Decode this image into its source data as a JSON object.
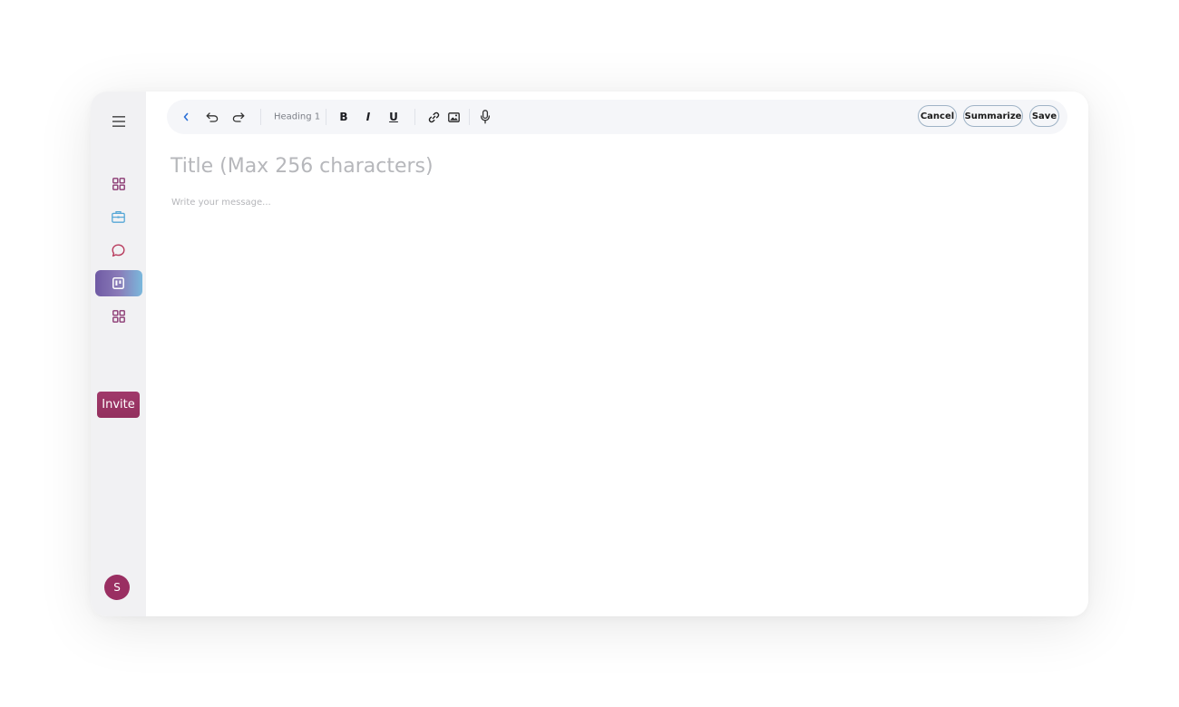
{
  "colors": {
    "accent_purple": "#9a2f62",
    "link_blue": "#2b6fd6",
    "sidebar_bg": "#f1f1f3",
    "toolbar_bg": "#f5f6f9",
    "placeholder_gray": "#b6b7bb",
    "active_gradient": [
      "#6f5aa4",
      "#7ab8dc"
    ]
  },
  "sidebar": {
    "menu_icon": "hamburger-menu-icon",
    "nav_items": [
      {
        "icon": "dashboard-grid-icon",
        "color": "#8b3a73",
        "active": false
      },
      {
        "icon": "briefcase-icon",
        "color": "#56a7d6",
        "active": false
      },
      {
        "icon": "chat-bubble-icon",
        "color": "#b83a5c",
        "active": false
      },
      {
        "icon": "kanban-board-icon",
        "color": "#ffffff",
        "active": true
      },
      {
        "icon": "dashboard-grid-icon",
        "color": "#8b3a73",
        "active": false
      }
    ],
    "invite_label": "Invite",
    "avatar_initial": "S"
  },
  "toolbar": {
    "back_icon": "chevron-left-icon",
    "undo_icon": "undo-icon",
    "redo_icon": "redo-icon",
    "heading_select": "Heading 1",
    "bold_label": "B",
    "italic_label": "I",
    "underline_label": "U",
    "link_icon": "link-icon",
    "image_icon": "image-icon",
    "mic_icon": "microphone-icon",
    "cancel_label": "Cancel",
    "summarize_label": "Summarize",
    "save_label": "Save"
  },
  "editor": {
    "title_placeholder": "Title (Max 256 characters)",
    "message_placeholder": "Write your message..."
  }
}
